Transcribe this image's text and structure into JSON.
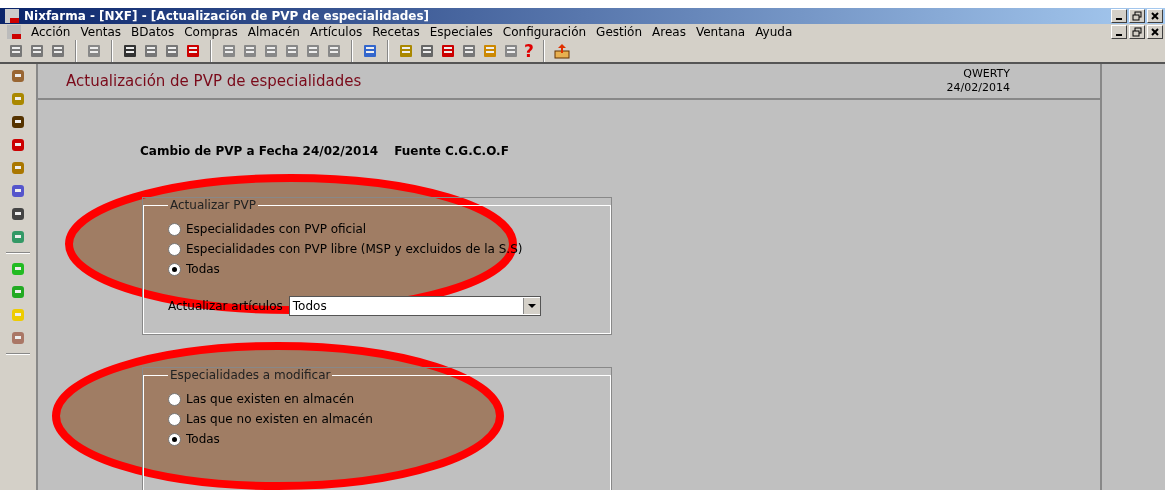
{
  "window": {
    "title": "Nixfarma - [NXF] - [Actualización de PVP de especialidades]"
  },
  "menu": [
    "Acción",
    "Ventas",
    "BDatos",
    "Compras",
    "Almacén",
    "Artículos",
    "Recetas",
    "Especiales",
    "Configuración",
    "Gestión",
    "Areas",
    "Ventana",
    "Ayuda"
  ],
  "help_glyph": "?",
  "form": {
    "title": "Actualización de PVP de especialidades",
    "user": "QWERTY",
    "date": "24/02/2014",
    "heading": "Cambio de PVP a Fecha 24/02/2014",
    "source": "Fuente C.G.C.O.F",
    "groups": [
      {
        "legend": "Actualizar PVP",
        "options": [
          {
            "label": "Especialidades con PVP oficial",
            "selected": false
          },
          {
            "label": "Especialidades con PVP libre (MSP y excluidos de la S.S)",
            "selected": false
          },
          {
            "label": "Todas",
            "selected": true
          }
        ],
        "field": {
          "label": "Actualizar artículos",
          "value": "Todos"
        }
      },
      {
        "legend": "Especialidades a modificar",
        "options": [
          {
            "label": "Las que existen en almacén",
            "selected": false
          },
          {
            "label": "Las que no existen en almacén",
            "selected": false
          },
          {
            "label": "Todas",
            "selected": true
          }
        ]
      }
    ]
  }
}
